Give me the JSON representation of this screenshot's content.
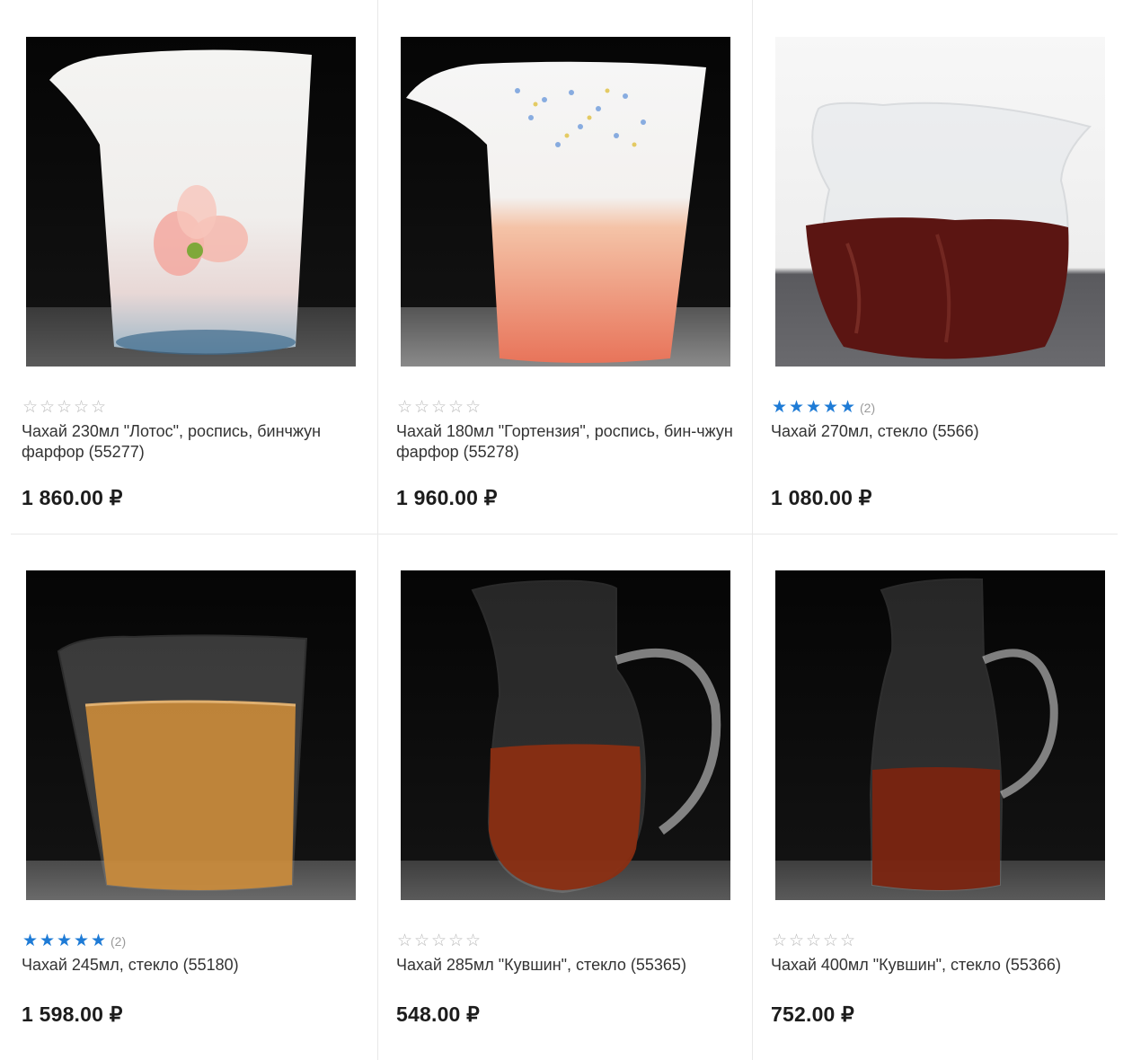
{
  "products": [
    {
      "name": "Чахай 230мл \"Лотос\", роспись, бинчжун фарфор (55277)",
      "price": "1 860.00 ₽",
      "rating": 0,
      "reviews": "",
      "image": "white porcelain pitcher with painted lotus"
    },
    {
      "name": "Чахай 180мл \"Гортензия\", роспись, бин-чжун фарфор (55278)",
      "price": "1 960.00 ₽",
      "rating": 0,
      "reviews": "",
      "image": "white porcelain pitcher with hydrangea painting"
    },
    {
      "name": "Чахай 270мл, стекло (5566)",
      "price": "1 080.00 ₽",
      "rating": 5,
      "reviews": "(2)",
      "image": "textured glass pitcher with dark tea"
    },
    {
      "name": "Чахай 245мл, стекло (55180)",
      "price": "1 598.00 ₽",
      "rating": 5,
      "reviews": "(2)",
      "image": "hammered glass pitcher with amber tea"
    },
    {
      "name": "Чахай 285мл \"Кувшин\", стекло (55365)",
      "price": "548.00 ₽",
      "rating": 0,
      "reviews": "",
      "image": "glass jug with handle"
    },
    {
      "name": "Чахай 400мл \"Кувшин\", стекло (55366)",
      "price": "752.00 ₽",
      "rating": 0,
      "reviews": "",
      "image": "tall glass jug with handle"
    }
  ],
  "colors": {
    "star_filled": "#1e7bd6",
    "star_empty": "#b9b9b9",
    "divider": "#e8e8e8"
  }
}
